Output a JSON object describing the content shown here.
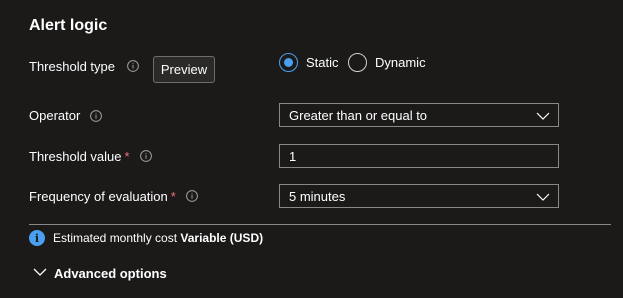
{
  "section": {
    "title": "Alert logic"
  },
  "threshold_type": {
    "label": "Threshold type",
    "preview_label": "Preview",
    "options": [
      {
        "label": "Static",
        "selected": true
      },
      {
        "label": "Dynamic",
        "selected": false
      }
    ]
  },
  "operator": {
    "label": "Operator",
    "value": "Greater than or equal to"
  },
  "threshold_value": {
    "label": "Threshold value",
    "required_mark": "*",
    "value": "1"
  },
  "frequency": {
    "label": "Frequency of evaluation",
    "required_mark": "*",
    "value": "5 minutes"
  },
  "cost": {
    "prefix": "Estimated monthly cost",
    "value": "Variable (USD)"
  },
  "advanced": {
    "label": "Advanced options"
  },
  "colors": {
    "background": "#1b1a19",
    "accent": "#4aa0f0",
    "required": "#f1707b",
    "border": "#8a8886"
  }
}
